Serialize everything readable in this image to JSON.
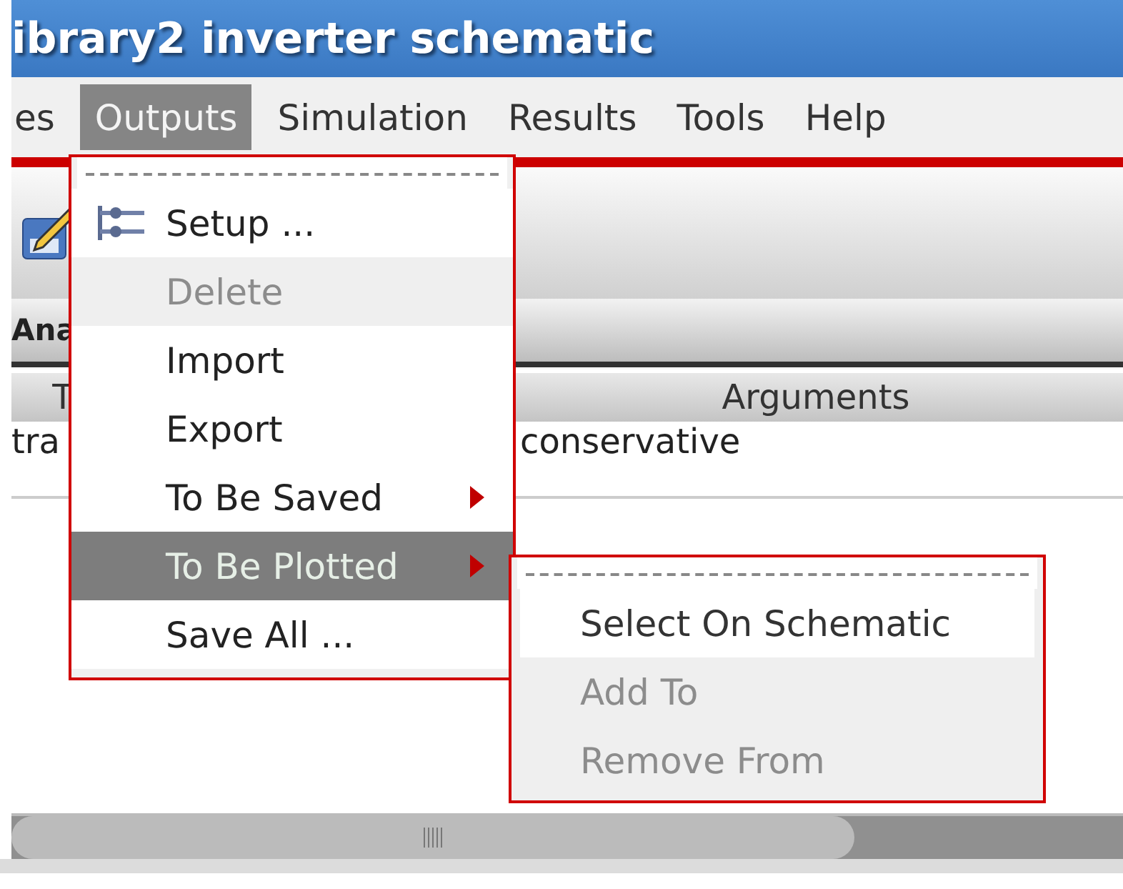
{
  "window": {
    "title": "ibrary2 inverter schematic"
  },
  "menubar": [
    {
      "label": "es",
      "selected": false
    },
    {
      "label": "Outputs",
      "selected": true
    },
    {
      "label": "Simulation",
      "selected": false
    },
    {
      "label": "Results",
      "selected": false
    },
    {
      "label": "Tools",
      "selected": false
    },
    {
      "label": "Help",
      "selected": false
    }
  ],
  "panel": {
    "title": "Ana"
  },
  "table": {
    "columns": [
      "T",
      "Arguments"
    ],
    "rows": [
      {
        "column_1": "tra",
        "column_3": "conservative"
      }
    ]
  },
  "outputs_menu": [
    {
      "label": "Setup ...",
      "kind": "icon",
      "disabled": false,
      "selected": false,
      "submenu": false
    },
    {
      "label": "Delete",
      "kind": "plain",
      "disabled": true,
      "selected": false,
      "submenu": false
    },
    {
      "label": "Import",
      "kind": "plain",
      "disabled": false,
      "selected": false,
      "submenu": false
    },
    {
      "label": "Export",
      "kind": "plain",
      "disabled": false,
      "selected": false,
      "submenu": false
    },
    {
      "label": "To Be Saved",
      "kind": "plain",
      "disabled": false,
      "selected": false,
      "submenu": true
    },
    {
      "label": "To Be Plotted",
      "kind": "plain",
      "disabled": false,
      "selected": true,
      "submenu": true
    },
    {
      "label": "Save All ...",
      "kind": "plain",
      "disabled": false,
      "selected": false,
      "submenu": false
    }
  ],
  "plotted_submenu": [
    {
      "label": "Select On Schematic",
      "disabled": false
    },
    {
      "label": "Add To",
      "disabled": true
    },
    {
      "label": "Remove From",
      "disabled": true
    }
  ]
}
